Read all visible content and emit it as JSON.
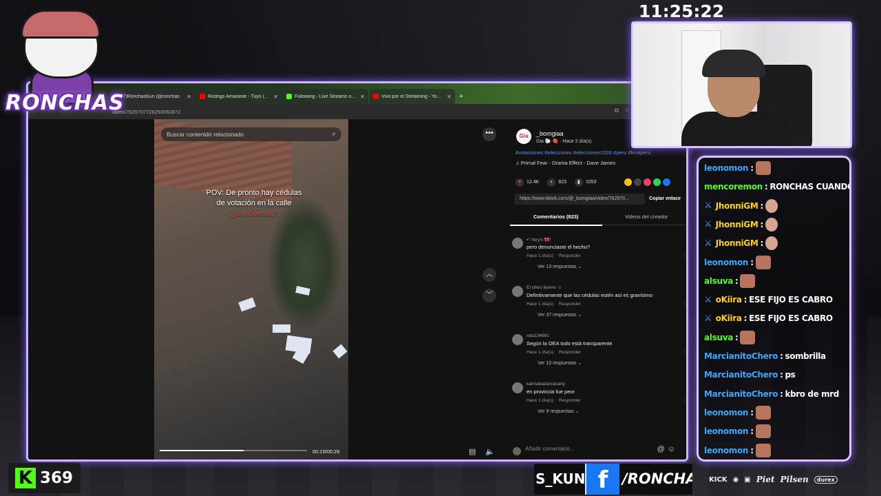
{
  "overlay": {
    "logo_text": "RONCHAS",
    "clock": "11:25:22",
    "kick_viewers": "369",
    "handle_left": "S_KUN",
    "facebook_icon": "f",
    "handle_right": "/RONCHAS",
    "sponsors": [
      "KICK",
      "Piet",
      "Pilsen",
      "durex"
    ]
  },
  "browser": {
    "tabs": [
      {
        "label": "(7)RonchasKun (@ronchas",
        "icon_color": "#ffffff",
        "active": true
      },
      {
        "label": "Rodrigo Amarante - Tuyo (Nar",
        "icon_color": "#ff0000",
        "active": false
      },
      {
        "label": "Following - Live Streams on K",
        "icon_color": "#53fc18",
        "active": false
      },
      {
        "label": "Vivo por el Streaming - YouTub",
        "icon_color": "#ff0000",
        "active": false
      }
    ],
    "new_tab": "+",
    "address": "video/7629707726293060872"
  },
  "video": {
    "search_placeholder": "Buscar contenido relacionado",
    "caption_line1": "POV: De pronto hay cédulas",
    "caption_line2": "de votación en la calle",
    "caption_red": "¿coincidencia?",
    "progress": 0.57,
    "time": "00:15/00:26"
  },
  "post": {
    "author": "_bomgiaa",
    "author_sub": "Gia 🐑 🍓 · Hace 2 día(s)",
    "hashtags": "#votaciones #elecciones #elecciones2026 #peru #limaperu",
    "music": "♫  Primal Fear - Drama Effect - Dave James",
    "likes": "12.4K",
    "comments_count": "823",
    "saves": "1053",
    "link": "https://www.tiktok.com/@_bomgiaa/video/762970...",
    "copy_label": "Copiar enlace",
    "tab_comments": "Comentarios (823)",
    "tab_creator": "Videos del creador",
    "add_comment_placeholder": "Añadir comentario..."
  },
  "comments": [
    {
      "user": "•°.Yery's 🎀!",
      "text": "pero denunciaste el hecho?",
      "time": "Hace 1 día(s)",
      "reply": "Responder",
      "more": "Ver 13 respuestas ⌄"
    },
    {
      "user": "El chico bueno ☺",
      "text": "Definitivamente que las cédulas estén así es gravísimo",
      "time": "Hace 1 día(s)",
      "reply": "Responder",
      "more": "Ver 37 respuestas ⌄"
    },
    {
      "user": "rata134891",
      "text": "Según la OEA todo está transparente",
      "time": "Hace 1 día(s)",
      "reply": "Responder",
      "more": "Ver 10 respuestas ⌄"
    },
    {
      "user": "karinabazancasany",
      "text": "en provincia fue peor",
      "time": "Hace 1 día(s)",
      "reply": "Responder",
      "more": "Ver 9 respuestas ⌄"
    }
  ],
  "chat": [
    {
      "user": "leonomon",
      "color": "#3aa8ff",
      "badge": false,
      "text": "",
      "emote": "emote"
    },
    {
      "user": "mencoremon",
      "color": "#53fc18",
      "badge": false,
      "text": "RONCHAS CUANDO",
      "emote": ""
    },
    {
      "user": "JhonniGM",
      "color": "#ffd400",
      "badge": true,
      "text": "",
      "emote": "face"
    },
    {
      "user": "JhonniGM",
      "color": "#ffd400",
      "badge": true,
      "text": "",
      "emote": "face"
    },
    {
      "user": "JhonniGM",
      "color": "#ffd400",
      "badge": true,
      "text": "",
      "emote": "face"
    },
    {
      "user": "leonomon",
      "color": "#3aa8ff",
      "badge": false,
      "text": "",
      "emote": "emote"
    },
    {
      "user": "alsuva",
      "color": "#53fc18",
      "badge": false,
      "text": "",
      "emote": "emote"
    },
    {
      "user": "oKiira",
      "color": "#ffd400",
      "badge": true,
      "text": "ESE FIJO ES CABRO",
      "emote": ""
    },
    {
      "user": "oKiira",
      "color": "#ffd400",
      "badge": true,
      "text": "ESE FIJO ES CABRO",
      "emote": ""
    },
    {
      "user": "alsuva",
      "color": "#53fc18",
      "badge": false,
      "text": "",
      "emote": "emote"
    },
    {
      "user": "MarcianitoChero",
      "color": "#3aa8ff",
      "badge": false,
      "text": "sombrilla",
      "emote": ""
    },
    {
      "user": "MarcianitoChero",
      "color": "#3aa8ff",
      "badge": false,
      "text": "ps",
      "emote": ""
    },
    {
      "user": "MarcianitoChero",
      "color": "#3aa8ff",
      "badge": false,
      "text": "kbro de mrd",
      "emote": ""
    },
    {
      "user": "leonomon",
      "color": "#3aa8ff",
      "badge": false,
      "text": "",
      "emote": "emote"
    },
    {
      "user": "leonomon",
      "color": "#3aa8ff",
      "badge": false,
      "text": "",
      "emote": "emote"
    },
    {
      "user": "leonomon",
      "color": "#3aa8ff",
      "badge": false,
      "text": "",
      "emote": "emote"
    }
  ]
}
